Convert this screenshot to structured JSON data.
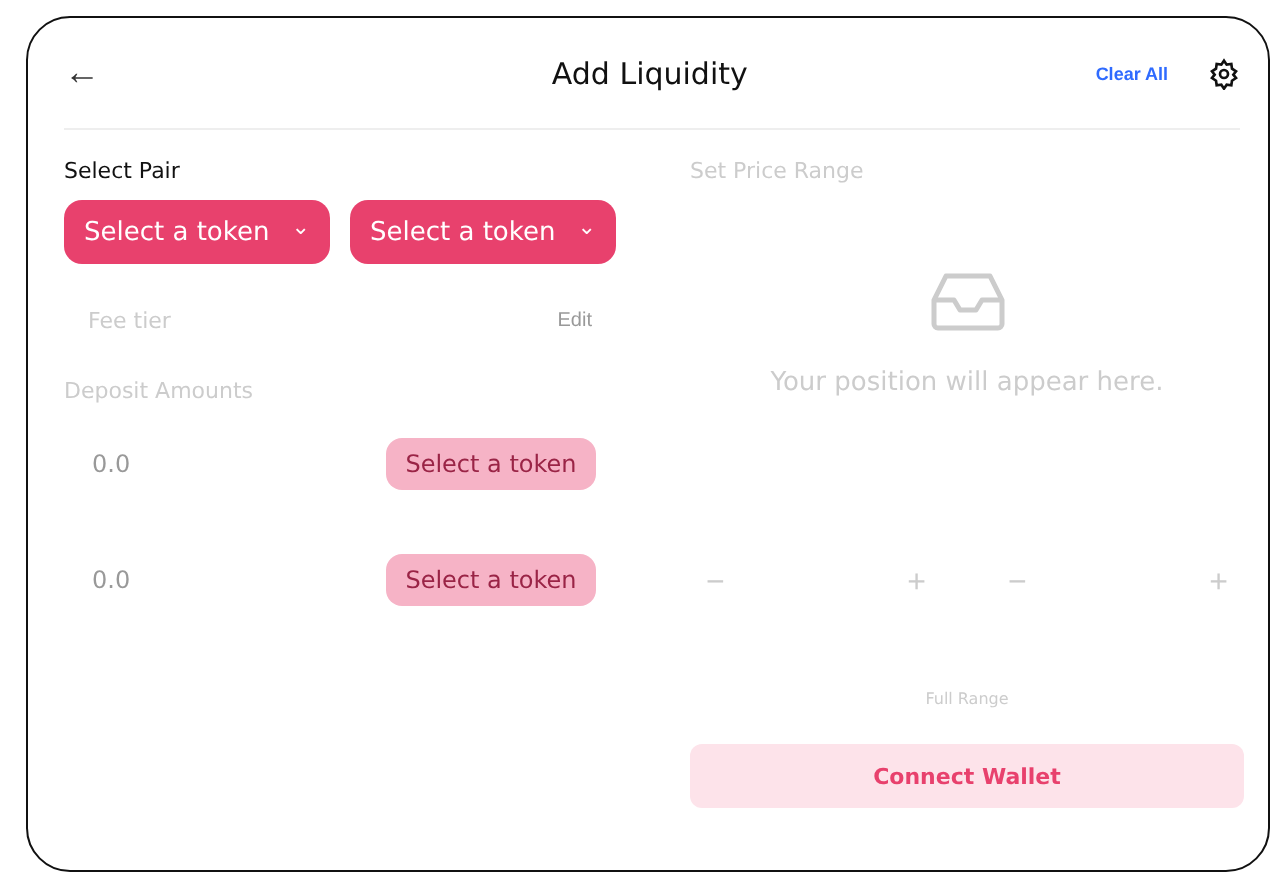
{
  "header": {
    "back": "←",
    "title": "Add Liquidity",
    "clear": "Clear All"
  },
  "pair": {
    "label": "Select Pair",
    "selectors": [
      {
        "label": "Select a token",
        "caret": "⌄",
        "disabled": false
      },
      {
        "label": "Select a token",
        "caret": "⌄",
        "disabled": false
      }
    ]
  },
  "fee_tier": {
    "label": "Fee tier",
    "action": "Edit",
    "disabled": true
  },
  "deposit": {
    "label": "Deposit Amounts",
    "disabled": true,
    "inputs": [
      {
        "placeholder": "0.0",
        "button": "Select a token",
        "disabled": true
      },
      {
        "placeholder": "0.0",
        "button": "Select a token",
        "disabled": true
      }
    ]
  },
  "price_range": {
    "label": "Set Price Range",
    "empty_message": "Your position will appear here.",
    "steppers": [
      {
        "minus": "−",
        "plus": "+"
      },
      {
        "minus": "−",
        "plus": "+"
      }
    ],
    "full_range": "Full Range",
    "disabled": true
  },
  "connect_button": {
    "label": "Connect Wallet"
  }
}
